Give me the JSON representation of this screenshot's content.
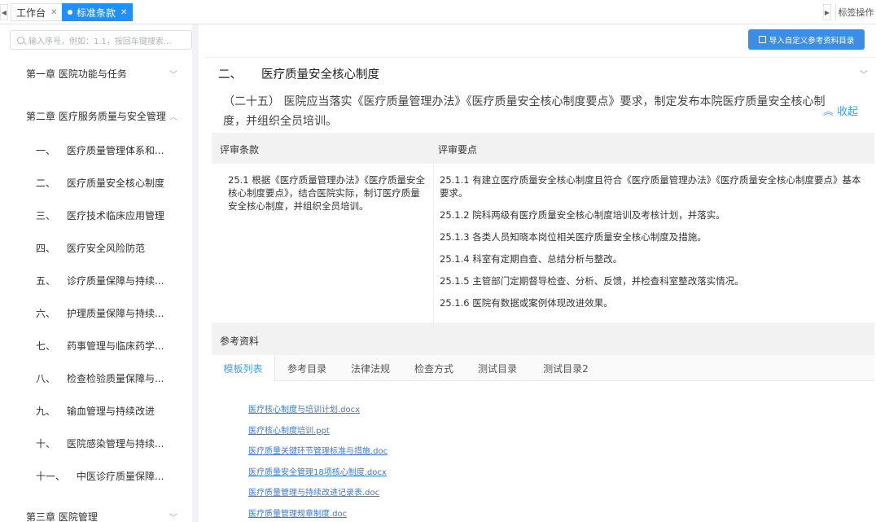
{
  "tabs": {
    "workbench": "工作台",
    "standards": "标准条款",
    "ops": "标签操作"
  },
  "sidebar": {
    "search_placeholder": "输入序号，例如：1.1，按回车键搜索...",
    "chapter1": "第一章  医院功能与任务",
    "chapter2": "第二章  医疗服务质量与安全管理",
    "chapter3": "第三章  医院管理",
    "sections": [
      {
        "num": "一、",
        "label": "医疗质量管理体系和..."
      },
      {
        "num": "二、",
        "label": "医疗质量安全核心制度"
      },
      {
        "num": "三、",
        "label": "医疗技术临床应用管理"
      },
      {
        "num": "四、",
        "label": "医疗安全风险防范"
      },
      {
        "num": "五、",
        "label": "诊疗质量保障与持续..."
      },
      {
        "num": "六、",
        "label": "护理质量保障与持续..."
      },
      {
        "num": "七、",
        "label": "药事管理与临床药学..."
      },
      {
        "num": "八、",
        "label": "检查检验质量保障与..."
      },
      {
        "num": "九、",
        "label": "输血管理与持续改进"
      },
      {
        "num": "十、",
        "label": "医院感染管理与持续..."
      },
      {
        "num": "十一、",
        "label": "中医诊疗质量保障..."
      }
    ]
  },
  "main": {
    "import_button": "导入自定义参考资料目录",
    "section_num": "二、",
    "section_title": "医疗质量安全核心制度",
    "clause": "（二十五） 医院应当落实《医疗质量管理办法》《医疗质量安全核心制度要点》要求，制定发布本院医疗质量安全核心制度，并组织全员培训。",
    "collapse": "收起",
    "table": {
      "col1": "评审条款",
      "col2": "评审要点",
      "clause_text": "25.1 根据《医疗质量管理办法》《医疗质量安全核心制度要点》，结合医院实际，制订医疗质量安全核心制度，并组织全员培训。",
      "points": [
        "25.1.1 有建立医疗质量安全核心制度且符合《医疗质量管理办法》《医疗质量安全核心制度要点》基本要求。",
        "25.1.2 院科两级有医疗质量安全核心制度培训及考核计划，并落实。",
        "25.1.3 各类人员知晓本岗位相关医疗质量安全核心制度及措施。",
        "25.1.4 科室有定期自查、总结分析与整改。",
        "25.1.5 主管部门定期督导检查、分析、反馈，并检查科室整改落实情况。",
        "25.1.6 医院有数据或案例体现改进效果。"
      ]
    },
    "references": {
      "title": "参考资料",
      "tabs": [
        "模板列表",
        "参考目录",
        "法律法规",
        "检查方式",
        "测试目录",
        "测试目录2"
      ],
      "files": [
        "医疗核心制度与培训计划.docx",
        "医疗核心制度培训.ppt",
        "医疗质量关键环节管理标准与措施.doc",
        "医疗质量安全管理18项核心制度.docx",
        "医疗质量管理与持续改进记录表.doc",
        "医疗质量管理规章制度.doc"
      ]
    }
  },
  "colors": {
    "accent": "#409eff",
    "active_tab": "#1e90ff",
    "button": "#3a8ee6"
  }
}
